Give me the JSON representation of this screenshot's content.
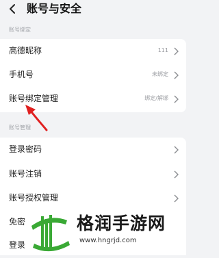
{
  "header": {
    "title": "账号与安全"
  },
  "sections": [
    {
      "label": "账号绑定"
    },
    {
      "label": "账号管理"
    }
  ],
  "binding_rows": [
    {
      "label": "高德昵称",
      "value": "111"
    },
    {
      "label": "手机号",
      "value": "未绑定"
    },
    {
      "label": "账号绑定管理",
      "value": "绑定/解绑"
    }
  ],
  "management_rows": [
    {
      "label": "登录密码"
    },
    {
      "label": "账号注销"
    },
    {
      "label": "账号授权管理"
    },
    {
      "label": "免密"
    },
    {
      "label": "登录"
    }
  ],
  "annotation": {
    "arrow_color": "#e02020"
  },
  "watermark": {
    "name": "格润手游网",
    "url": "www.hngrjd.com",
    "logo_color": "#3aa935"
  },
  "icons": {
    "back": "chevron-left-icon",
    "row": "chevron-right-icon"
  }
}
